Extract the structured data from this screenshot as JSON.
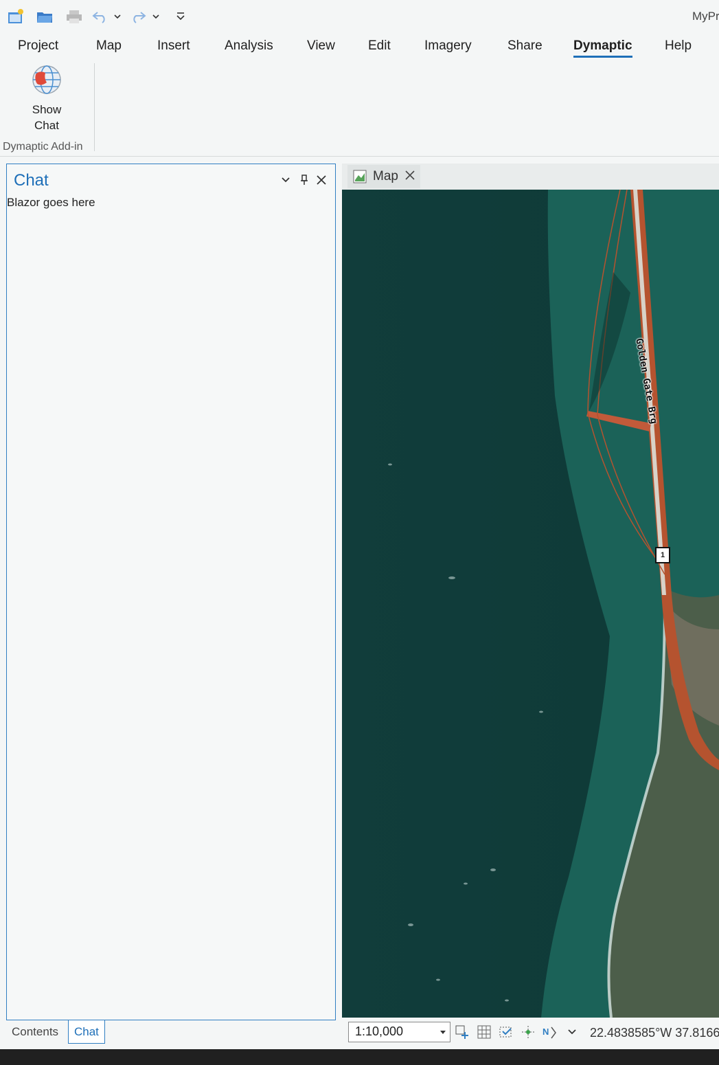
{
  "window": {
    "title_partial": "MyPr"
  },
  "quick_access": {
    "icons": [
      "new-project-icon",
      "open-project-icon",
      "print-icon",
      "undo-icon",
      "undo-dropdown-icon",
      "redo-icon",
      "redo-dropdown-icon",
      "customize-qat-icon"
    ]
  },
  "ribbon": {
    "tabs": [
      {
        "label": "Project"
      },
      {
        "label": "Map"
      },
      {
        "label": "Insert"
      },
      {
        "label": "Analysis"
      },
      {
        "label": "View"
      },
      {
        "label": "Edit"
      },
      {
        "label": "Imagery"
      },
      {
        "label": "Share"
      },
      {
        "label": "Dymaptic",
        "active": true
      },
      {
        "label": "Help"
      }
    ],
    "show_chat": {
      "line1": "Show",
      "line2": "Chat",
      "icon": "globe-icon"
    },
    "group_label": "Dymaptic Add-in"
  },
  "chat_pane": {
    "title": "Chat",
    "content": "Blazor goes here",
    "buttons": [
      "chevron-down-icon",
      "pin-icon",
      "close-icon"
    ]
  },
  "bottom_tabs": [
    {
      "label": "Contents"
    },
    {
      "label": "Chat",
      "active": true
    }
  ],
  "map_view": {
    "tab_label": "Map",
    "road_label": "Golden Gate Brg",
    "route_shield": "1",
    "scale": "1:10,000",
    "coordinates": "22.4838585°W 37.8166"
  },
  "colors": {
    "accent": "#1e6fb8",
    "water_deep": "#0f3f3c",
    "water_shallow": "#1e6b62",
    "bridge": "#b5532f"
  }
}
